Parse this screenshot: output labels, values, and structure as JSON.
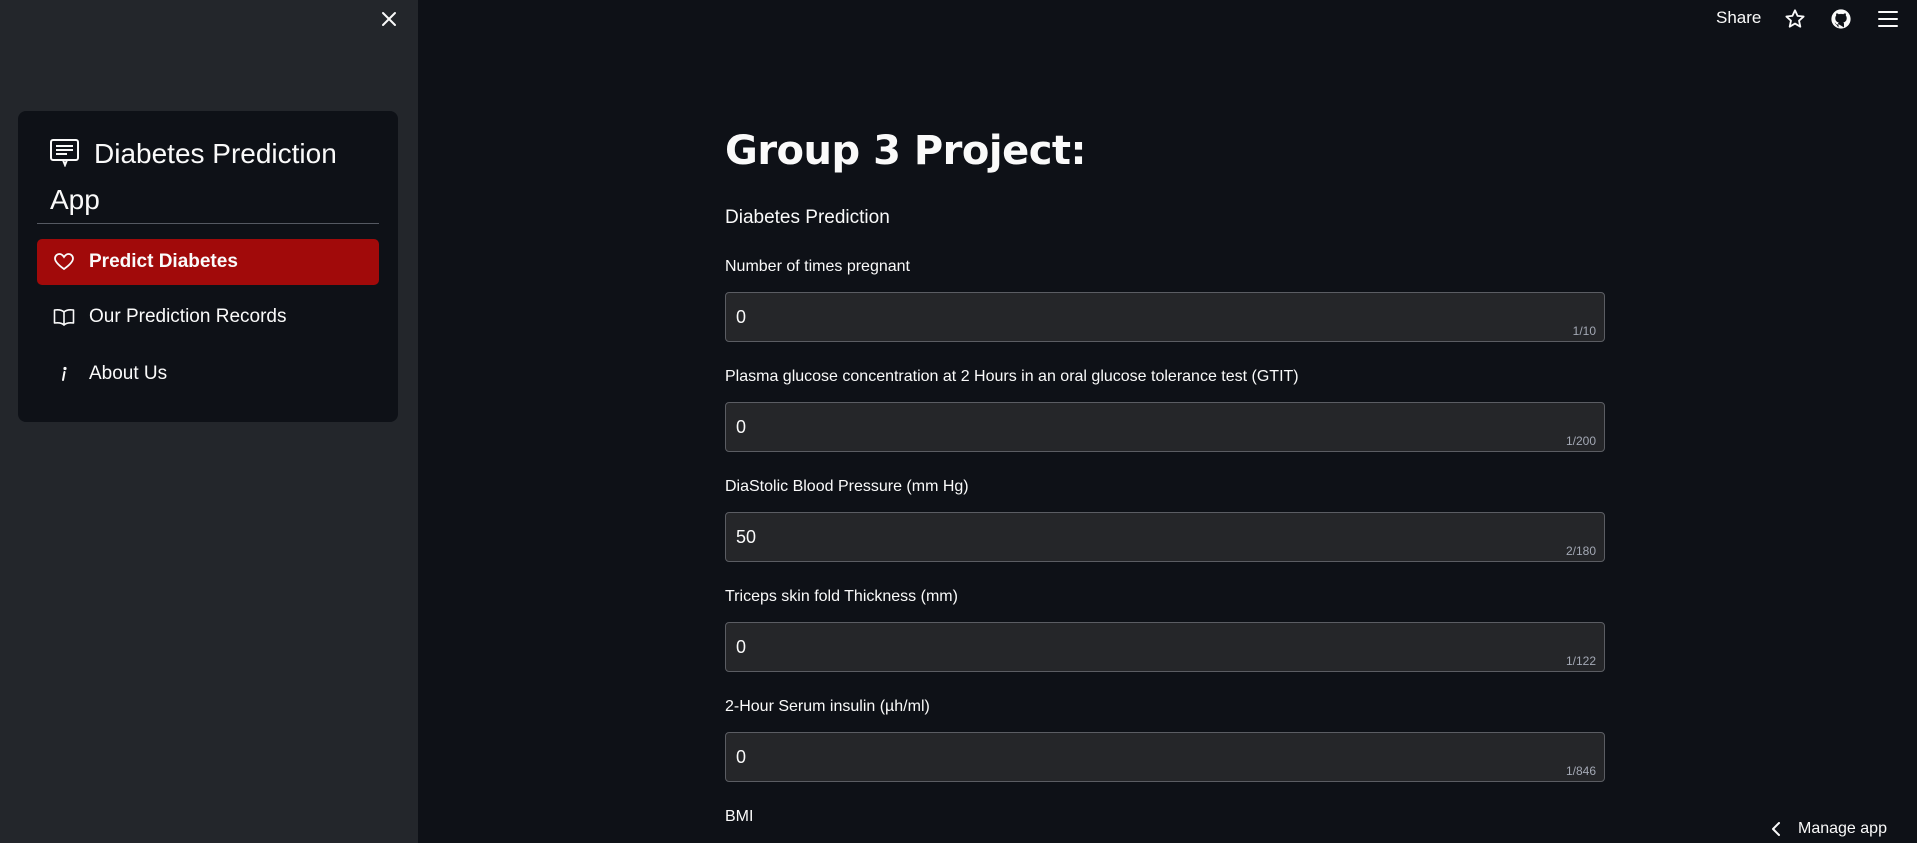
{
  "sidebar": {
    "title": "Diabetes Prediction App",
    "items": [
      {
        "label": "Predict Diabetes",
        "icon": "heart-icon",
        "active": true
      },
      {
        "label": "Our Prediction Records",
        "icon": "book-icon",
        "active": false
      },
      {
        "label": "About Us",
        "icon": "info-icon",
        "active": false
      }
    ]
  },
  "topbar": {
    "share_label": "Share",
    "icons": [
      "star-icon",
      "github-icon",
      "hamburger-menu-icon"
    ]
  },
  "main": {
    "title": "Group 3 Project:",
    "subtitle": "Diabetes Prediction",
    "fields": [
      {
        "label": "Number of times pregnant",
        "value": "0",
        "counter": "1/10"
      },
      {
        "label": "Plasma glucose concentration at 2 Hours in an oral glucose tolerance test (GTIT)",
        "value": "0",
        "counter": "1/200"
      },
      {
        "label": "DiaStolic Blood Pressure (mm Hg)",
        "value": "50",
        "counter": "2/180"
      },
      {
        "label": "Triceps skin fold Thickness (mm)",
        "value": "0",
        "counter": "1/122"
      },
      {
        "label": "2-Hour Serum insulin (µh/ml)",
        "value": "0",
        "counter": "1/846"
      },
      {
        "label": "BMI"
      }
    ]
  },
  "footer": {
    "manage_app_label": "Manage app"
  },
  "colors": {
    "accent": "#a10a0a",
    "background": "#0e1117",
    "sidebar": "#23262b"
  }
}
